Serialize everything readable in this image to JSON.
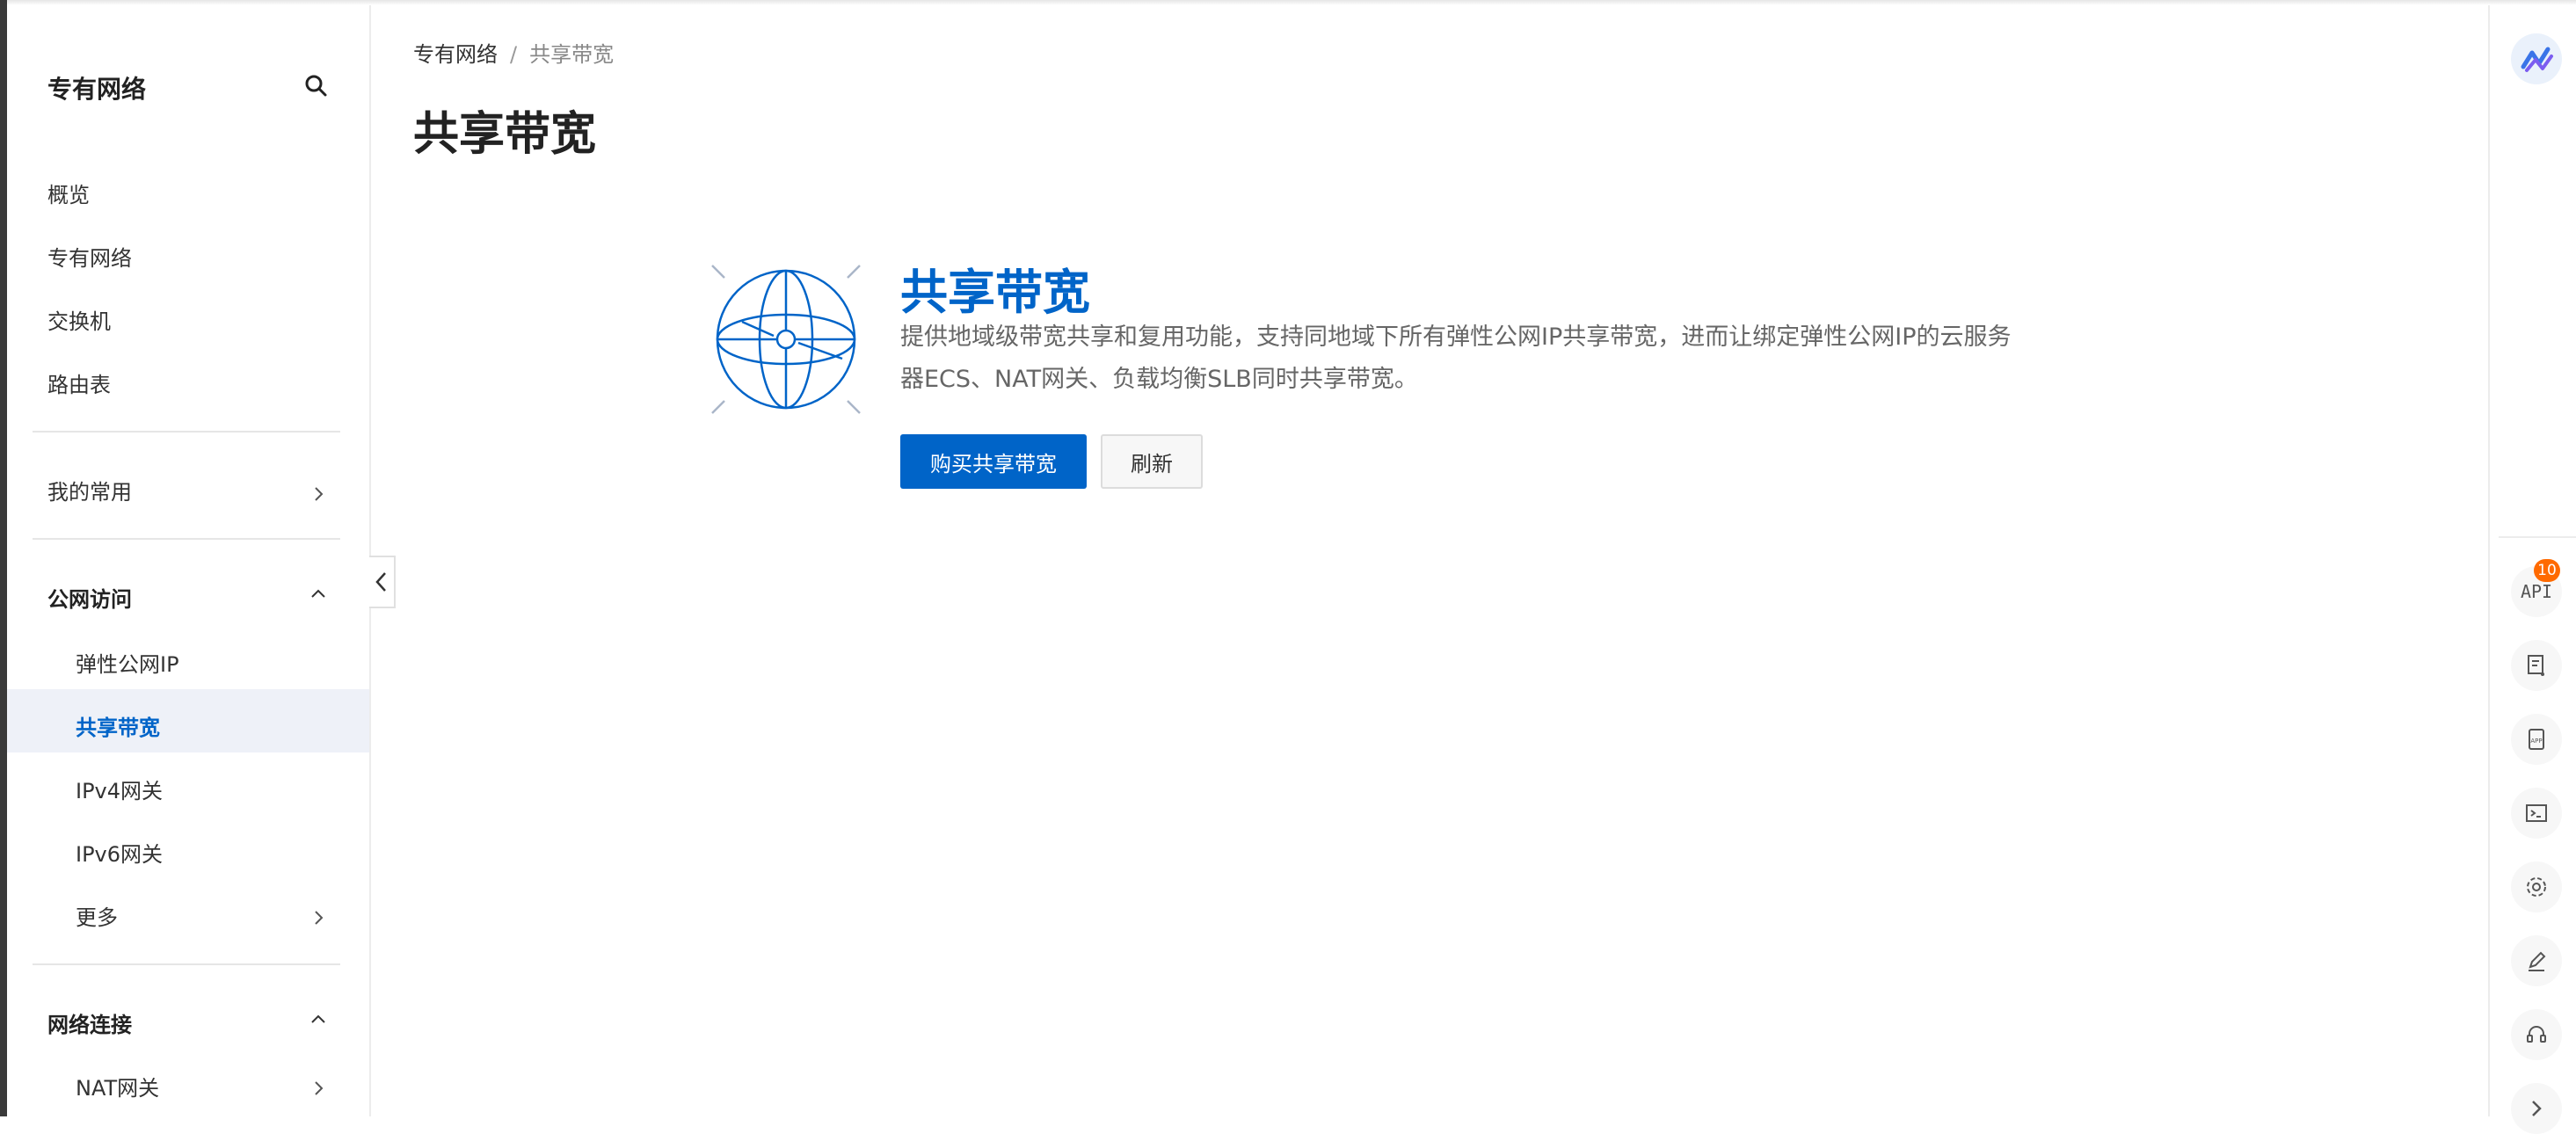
{
  "sidebar": {
    "title": "专有网络",
    "top_items": [
      "概览",
      "专有网络",
      "交换机",
      "路由表"
    ],
    "favorites": "我的常用",
    "group_public": "公网访问",
    "public_items": [
      "弹性公网IP",
      "共享带宽",
      "IPv4网关",
      "IPv6网关",
      "更多"
    ],
    "group_network": "网络连接",
    "network_items": [
      "NAT网关"
    ]
  },
  "breadcrumb": {
    "root": "专有网络",
    "separator": "/",
    "current": "共享带宽"
  },
  "page": {
    "title": "共享带宽"
  },
  "hero": {
    "title": "共享带宽",
    "desc_line1": "提供地域级带宽共享和复用功能，支持同地域下所有弹性公网IP共享带宽，进而让绑定弹性公网IP的云服务",
    "desc_line2": "器ECS、NAT网关、负载均衡SLB同时共享带宽。",
    "buy_label": "购买共享带宽",
    "refresh_label": "刷新"
  },
  "rail": {
    "api_label": "API",
    "api_badge": "10"
  },
  "colors": {
    "accent": "#0064c8",
    "badge": "#ff6a00",
    "active_bg": "#eef1f8"
  }
}
